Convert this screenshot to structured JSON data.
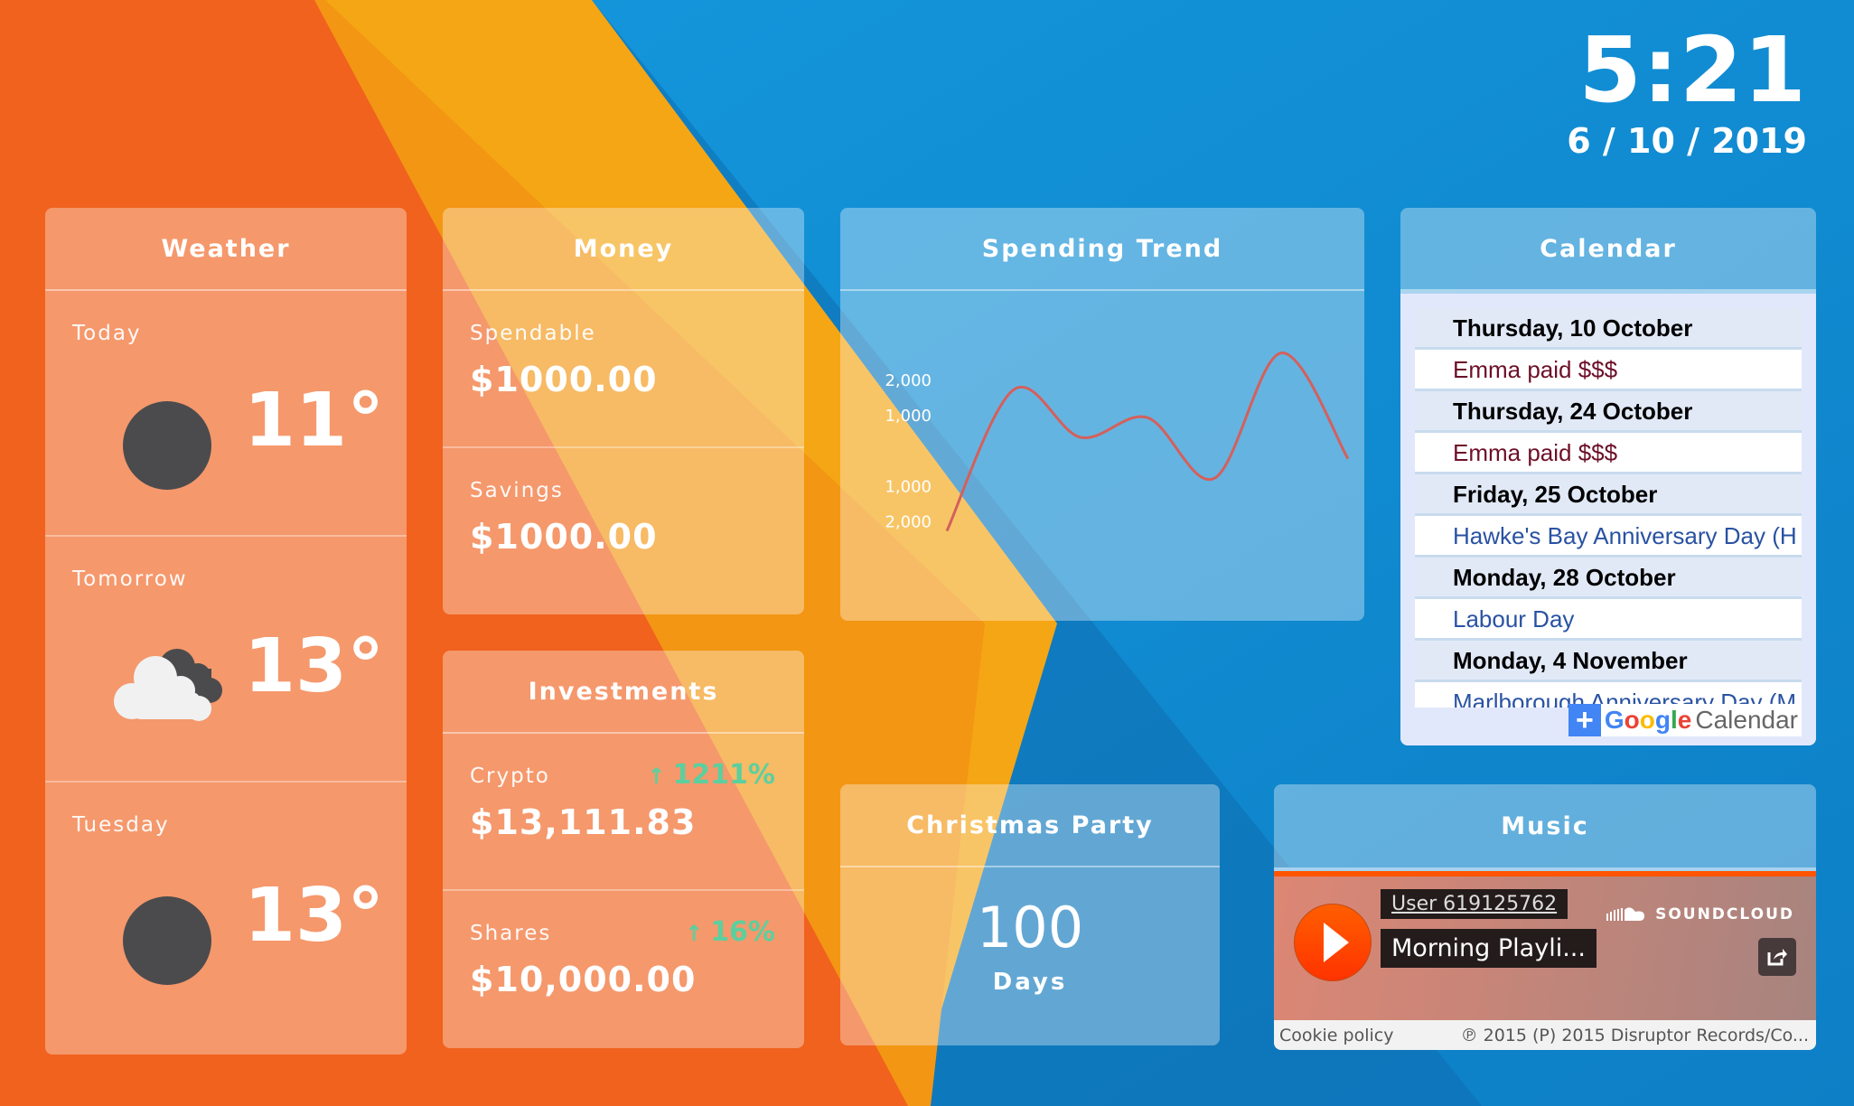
{
  "clock": {
    "time": "5:21",
    "date": "6 / 10 / 2019"
  },
  "weather": {
    "title": "Weather",
    "days": [
      {
        "label": "Today",
        "temp": "11°",
        "icon": "moon-icon"
      },
      {
        "label": "Tomorrow",
        "temp": "13°",
        "icon": "cloudy-night-icon"
      },
      {
        "label": "Tuesday",
        "temp": "13°",
        "icon": "moon-icon"
      }
    ]
  },
  "money": {
    "title": "Money",
    "items": [
      {
        "label": "Spendable",
        "value": "$1000.00"
      },
      {
        "label": "Savings",
        "value": "$1000.00"
      }
    ]
  },
  "investments": {
    "title": "Investments",
    "items": [
      {
        "label": "Crypto",
        "value": "$13,111.83",
        "change": "1211%",
        "direction": "up"
      },
      {
        "label": "Shares",
        "value": "$10,000.00",
        "change": "16%",
        "direction": "up"
      }
    ],
    "positive_color": "#5ccf9e"
  },
  "spending": {
    "title": "Spending Trend"
  },
  "chart_data": {
    "type": "line",
    "title": "Spending Trend",
    "xlabel": "",
    "ylabel": "",
    "ytick_labels": [
      "2,000",
      "1,000",
      "1,000",
      "2,000"
    ],
    "ytick_values": [
      2000,
      1000,
      -1000,
      -2000
    ],
    "ylim": [
      -2500,
      3000
    ],
    "grid": false,
    "series": [
      {
        "name": "spending",
        "color": "#d4605c",
        "x": [
          0,
          1,
          2,
          3,
          4,
          5,
          6
        ],
        "values": [
          -2260,
          1740,
          390,
          950,
          -770,
          2780,
          -215
        ]
      }
    ]
  },
  "calendar": {
    "title": "Calendar",
    "entries": [
      {
        "day": "Thursday, 10 October",
        "event": "Emma paid $$$",
        "kind": "red"
      },
      {
        "day": "Thursday, 24 October",
        "event": "Emma paid $$$",
        "kind": "red"
      },
      {
        "day": "Friday, 25 October",
        "event": "Hawke's Bay Anniversary Day (H",
        "kind": "blue"
      },
      {
        "day": "Monday, 28 October",
        "event": "Labour Day",
        "kind": "blue"
      },
      {
        "day": "Monday, 4 November",
        "event": "Marlborough Anniversary Day (M",
        "kind": "blue"
      }
    ],
    "add_button": {
      "plus": "+",
      "google": "Google",
      "calendar": "Calendar"
    }
  },
  "christmas": {
    "title": "Christmas Party",
    "count": "100",
    "unit": "Days"
  },
  "music": {
    "title": "Music",
    "user": "User 619125762",
    "track": "Morning Playli...",
    "brand": "SOUNDCLOUD",
    "footer_left": "Cookie policy",
    "footer_right": "℗ 2015 (P) 2015 Disruptor Records/Co..."
  }
}
